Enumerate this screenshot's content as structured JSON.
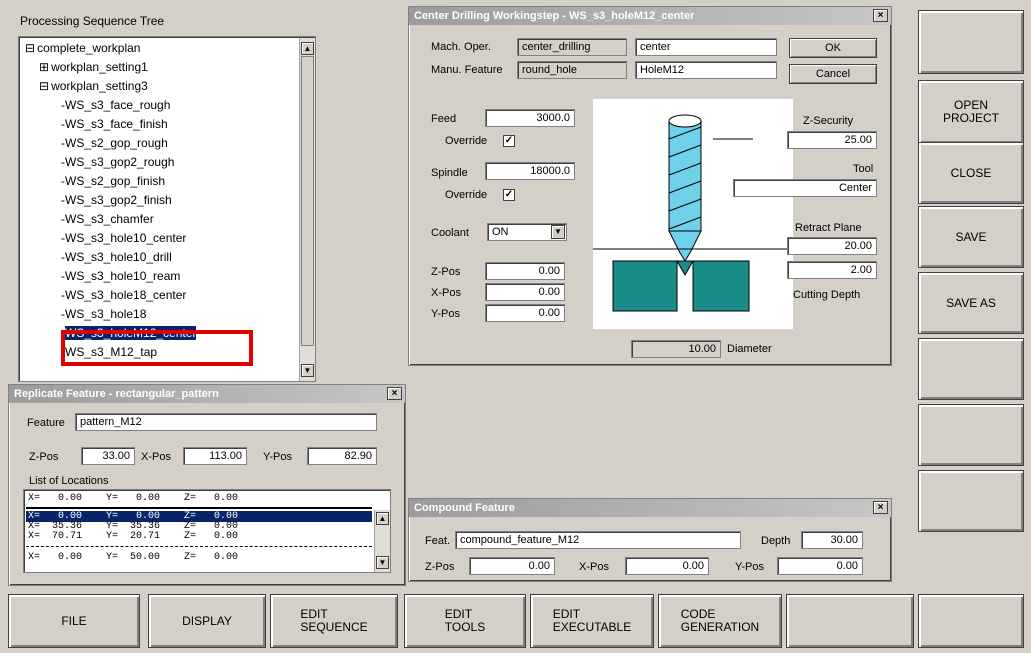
{
  "tree": {
    "title": "Processing Sequence Tree",
    "items": [
      {
        "prefix": "⊟",
        "label": "complete_workplan"
      },
      {
        "prefix": "⊞",
        "label": "workplan_setting1"
      },
      {
        "prefix": "⊟",
        "label": "workplan_setting3"
      },
      {
        "prefix": "",
        "label": "WS_s3_face_rough"
      },
      {
        "prefix": "",
        "label": "WS_s3_face_finish"
      },
      {
        "prefix": "",
        "label": "WS_s2_gop_rough"
      },
      {
        "prefix": "",
        "label": "WS_s3_gop2_rough"
      },
      {
        "prefix": "",
        "label": "WS_s2_gop_finish"
      },
      {
        "prefix": "",
        "label": "WS_s3_gop2_finish"
      },
      {
        "prefix": "",
        "label": "WS_s3_chamfer"
      },
      {
        "prefix": "",
        "label": "WS_s3_hole10_center"
      },
      {
        "prefix": "",
        "label": "WS_s3_hole10_drill"
      },
      {
        "prefix": "",
        "label": "WS_s3_hole10_ream"
      },
      {
        "prefix": "",
        "label": "WS_s3_hole18_center"
      },
      {
        "prefix": "",
        "label": "WS_s3_hole18"
      },
      {
        "prefix": "",
        "label": "WS_s3_holeM12_center"
      },
      {
        "prefix": "",
        "label": "WS_s3_M12_tap"
      }
    ]
  },
  "center_drilling": {
    "title": "Center Drilling Workingstep - WS_s3_holeM12_center",
    "mach_oper_label": "Mach. Oper.",
    "mach_oper_value": "center_drilling",
    "mach_oper_name": "center",
    "manu_feature_label": "Manu. Feature",
    "manu_feature_value": "round_hole",
    "manu_feature_name": "HoleM12",
    "ok": "OK",
    "cancel": "Cancel",
    "feed_label": "Feed",
    "feed_value": "3000.0",
    "override_label": "Override",
    "override1_checked": "✓",
    "spindle_label": "Spindle",
    "spindle_value": "18000.0",
    "override2_checked": "✓",
    "coolant_label": "Coolant",
    "coolant_value": "ON",
    "zpos_label": "Z-Pos",
    "zpos_value": "0.00",
    "xpos_label": "X-Pos",
    "xpos_value": "0.00",
    "ypos_label": "Y-Pos",
    "ypos_value": "0.00",
    "zsecurity_label": "Z-Security",
    "zsecurity_value": "25.00",
    "tool_label": "Tool",
    "tool_value": "Center",
    "retract_label": "Retract Plane",
    "retract_value": "20.00",
    "cutting_depth_value": "2.00",
    "cutting_depth_label": "Cutting Depth",
    "diameter_value": "10.00",
    "diameter_label": "Diameter"
  },
  "replicate": {
    "title": "Replicate Feature - rectangular_pattern",
    "feature_label": "Feature",
    "feature_value": "pattern_M12",
    "zpos_label": "Z-Pos",
    "zpos_value": "33.00",
    "xpos_label": "X-Pos",
    "xpos_value": "113.00",
    "ypos_label": "Y-Pos",
    "ypos_value": "82.90",
    "list_label": "List of Locations",
    "header_row": "X=   0.00    Y=   0.00    Z=   0.00",
    "rows": [
      "X=   0.00    Y=   0.00    Z=   0.00",
      "X=  35.36    Y=  35.36    Z=   0.00",
      "X=  70.71    Y=  20.71    Z=   0.00"
    ],
    "bottom_row": "X=   0.00    Y=  50.00    Z=   0.00"
  },
  "compound": {
    "title": "Compound Feature",
    "feat_label": "Feat.",
    "feat_value": "compound_feature_M12",
    "depth_label": "Depth",
    "depth_value": "30.00",
    "zpos_label": "Z-Pos",
    "zpos_value": "0.00",
    "xpos_label": "X-Pos",
    "xpos_value": "0.00",
    "ypos_label": "Y-Pos",
    "ypos_value": "0.00"
  },
  "right_buttons": {
    "open_project": "OPEN\nPROJECT",
    "close": "CLOSE",
    "save": "SAVE",
    "save_as": "SAVE AS"
  },
  "bottom_buttons": {
    "file": "FILE",
    "display": "DISPLAY",
    "edit_sequence": "EDIT\nSEQUENCE",
    "edit_tools": "EDIT\nTOOLS",
    "edit_executable": "EDIT\nEXECUTABLE",
    "code_generation": "CODE\nGENERATION"
  },
  "colors": {
    "highlight": "#0a246a",
    "annotation": "#e00000",
    "teal": "#1a8c88"
  }
}
